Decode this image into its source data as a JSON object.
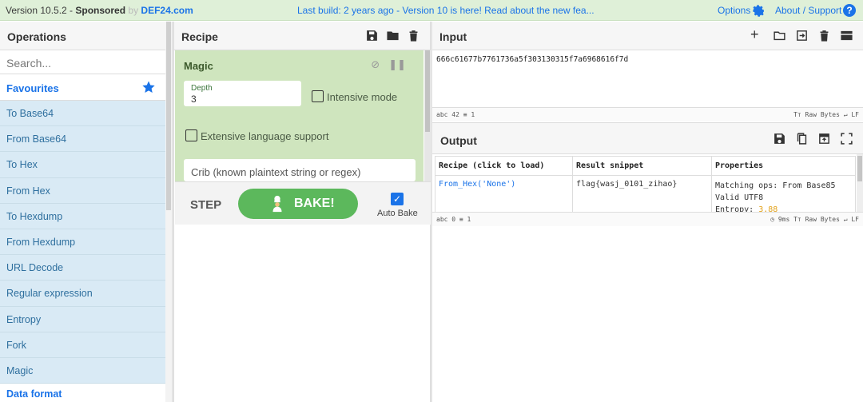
{
  "topbar": {
    "version": "Version 10.5.2 - ",
    "sponsored": "Sponsored",
    "by": " by ",
    "sponsor_link": "DEF24.com",
    "build_msg": "Last build: 2 years ago - Version 10 is here! Read about the new fea...",
    "options": "Options",
    "about": "About / Support"
  },
  "operations": {
    "title": "Operations",
    "search_placeholder": "Search...",
    "favourites": "Favourites",
    "items": [
      "To Base64",
      "From Base64",
      "To Hex",
      "From Hex",
      "To Hexdump",
      "From Hexdump",
      "URL Decode",
      "Regular expression",
      "Entropy",
      "Fork",
      "Magic"
    ],
    "category": "Data format"
  },
  "recipe": {
    "title": "Recipe",
    "op_name": "Magic",
    "depth_label": "Depth",
    "depth_value": "3",
    "intensive_label": "Intensive mode",
    "extensive_label": "Extensive language support",
    "crib_placeholder": "Crib (known plaintext string or regex)",
    "step_label": "STEP",
    "bake_label": "BAKE!",
    "autobake_label": "Auto Bake"
  },
  "input": {
    "title": "Input",
    "value": "666c61677b7761736a5f303130315f7a6968616f7d",
    "status_left": "abc 42  ≡ 1",
    "status_right": "Tт Raw Bytes  ↵ LF"
  },
  "output": {
    "title": "Output",
    "headers": [
      "Recipe (click to load)",
      "Result snippet",
      "Properties"
    ],
    "row": {
      "recipe": "From_Hex('None')",
      "snippet": "flag{wasj_0101_zihao}",
      "prop1": "Matching ops: From Base85",
      "prop2": "Valid UTF8",
      "prop3_label": "Entropy: ",
      "prop3_value": "3.88"
    },
    "status_left": "abc 0  ≡ 1",
    "status_right": "◷ 9ms  Tт Raw Bytes  ↵ LF"
  },
  "colors": {
    "accent": "#1a73e8",
    "recipe_bg": "#cfe5be",
    "bake": "#5cb85c",
    "entropy": "#e3a21a"
  }
}
